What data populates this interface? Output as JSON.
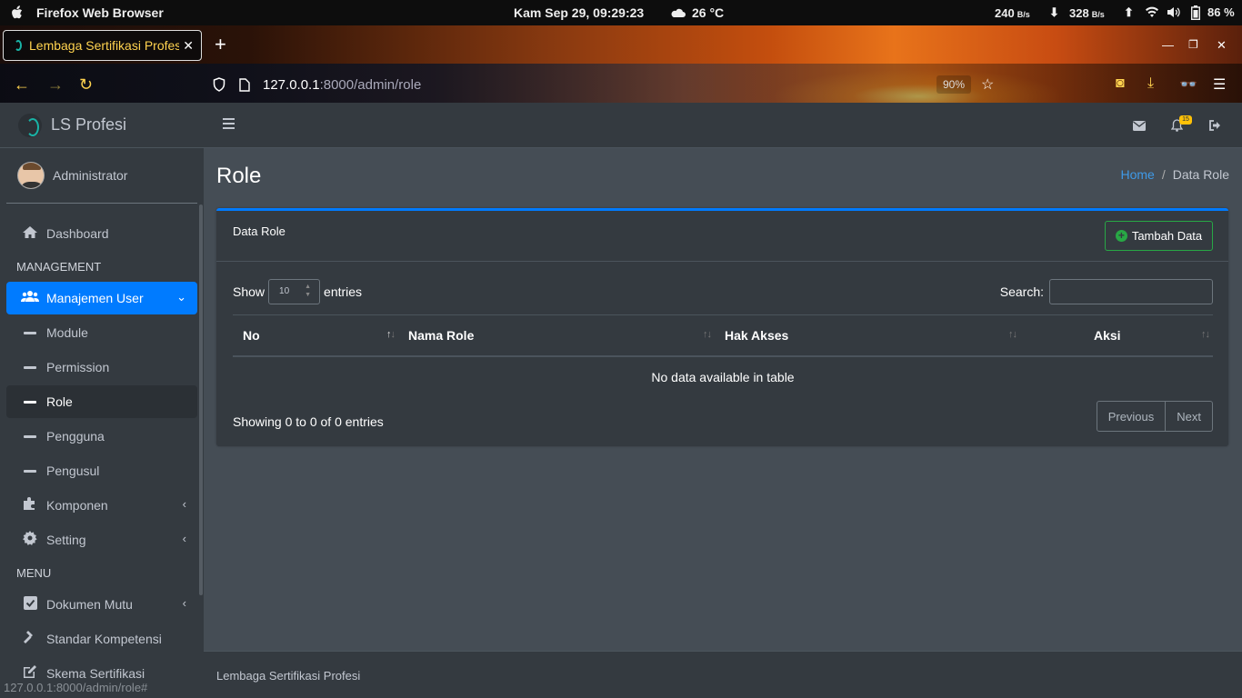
{
  "os": {
    "app_name": "Firefox Web Browser",
    "clock": "Kam Sep 29, 09:29:23",
    "weather_icon": "cloud-icon",
    "temperature": "26 °C",
    "net_up": "240",
    "net_up_unit": "B/s",
    "net_down": "328",
    "net_down_unit": "B/s",
    "battery": "86 %"
  },
  "browser": {
    "tab_title": "Lembaga Sertifikasi Profesi",
    "url_host": "127.0.0.1",
    "url_path": ":8000/admin/role",
    "zoom": "90%",
    "status_url": "127.0.0.1:8000/admin/role#"
  },
  "sidebar": {
    "brand": "LS Profesi",
    "user": "Administrator",
    "dashboard": "Dashboard",
    "header_management": "MANAGEMENT",
    "manajemen_user": "Manajemen User",
    "sub_module": "Module",
    "sub_permission": "Permission",
    "sub_role": "Role",
    "sub_pengguna": "Pengguna",
    "sub_pengusul": "Pengusul",
    "komponen": "Komponen",
    "setting": "Setting",
    "header_menu": "MENU",
    "dokumen_mutu": "Dokumen Mutu",
    "standar_kompetensi": "Standar Kompetensi",
    "skema_sertifikasi": "Skema Sertifikasi"
  },
  "topnav": {
    "notif_count": "15"
  },
  "content": {
    "page_title": "Role",
    "breadcrumb_home": "Home",
    "breadcrumb_sep": "/",
    "breadcrumb_current": "Data Role",
    "card_title": "Data Role",
    "add_button": "Tambah Data",
    "show_label": "Show",
    "entries_label": "entries",
    "length_value": "10",
    "search_label": "Search:",
    "columns": [
      "No",
      "Nama Role",
      "Hak Akses",
      "Aksi"
    ],
    "empty_message": "No data available in table",
    "info": "Showing 0 to 0 of 0 entries",
    "prev": "Previous",
    "next": "Next"
  },
  "footer": {
    "text": "Lembaga Sertifikasi Profesi"
  },
  "colors": {
    "accent": "#007bff",
    "success": "#28a745",
    "sidebar_bg": "#343a40",
    "content_bg": "#454d55"
  }
}
